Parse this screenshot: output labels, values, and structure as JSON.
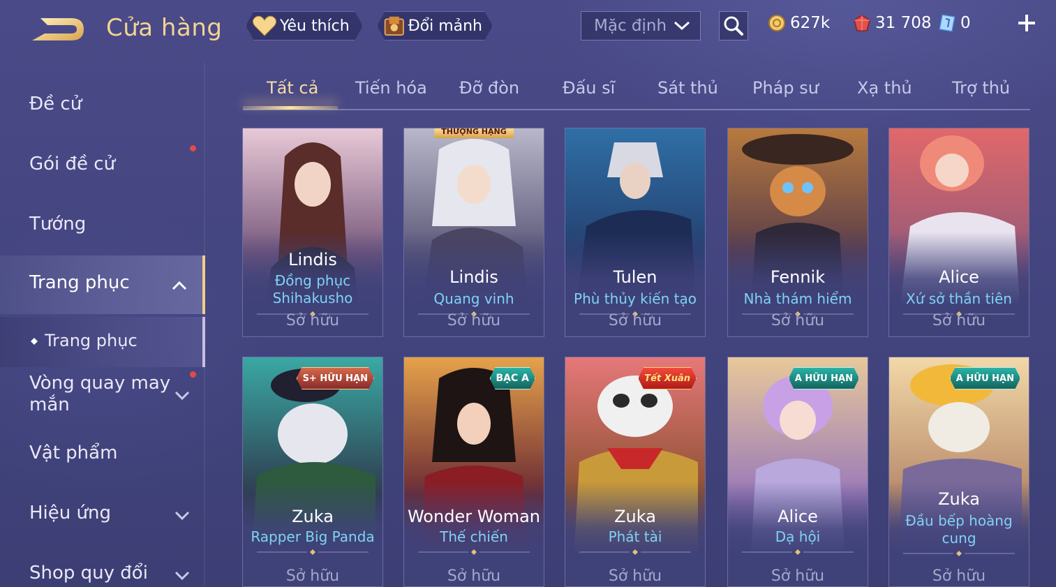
{
  "header": {
    "title": "Cửa hàng",
    "favorite_label": "Yêu thích",
    "exchange_label": "Đổi mảnh",
    "sort_value": "Mặc định",
    "gold": "627k",
    "gems": "31 708",
    "tickets": "0"
  },
  "sidebar": {
    "items": [
      {
        "label": "Đề cử"
      },
      {
        "label": "Gói đề cử"
      },
      {
        "label": "Tướng"
      },
      {
        "label": "Trang phục"
      },
      {
        "label": "Trang phục"
      },
      {
        "label": "Vòng quay may\nmắn"
      },
      {
        "label": "Vật phẩm"
      },
      {
        "label": "Hiệu ứng"
      },
      {
        "label": "Shop quy đổi"
      }
    ]
  },
  "tabs": [
    "Tất cả",
    "Tiến hóa",
    "Đỡ đòn",
    "Đấu sĩ",
    "Sát thủ",
    "Pháp sư",
    "Xạ thủ",
    "Trợ thủ"
  ],
  "cards": [
    {
      "hero": "Lindis",
      "skin": "Đồng phục Shihakusho",
      "status": "Sở hữu",
      "badge": ""
    },
    {
      "hero": "Lindis",
      "skin": "Quang vinh",
      "status": "Sở hữu",
      "badge": "THƯỢNG HẠNG"
    },
    {
      "hero": "Tulen",
      "skin": "Phù thủy kiến tạo",
      "status": "Sở hữu",
      "badge": ""
    },
    {
      "hero": "Fennik",
      "skin": "Nhà thám hiểm",
      "status": "Sở hữu",
      "badge": ""
    },
    {
      "hero": "Alice",
      "skin": "Xứ sở thần tiên",
      "status": "Sở hữu",
      "badge": ""
    },
    {
      "hero": "Zuka",
      "skin": "Rapper Big Panda",
      "status": "Sở hữu",
      "badge": "S+ HỮU HẠN"
    },
    {
      "hero": "Wonder Woman",
      "skin": "Thế chiến",
      "status": "Sở hữu",
      "badge": "BẠC A"
    },
    {
      "hero": "Zuka",
      "skin": "Phát tài",
      "status": "Sở hữu",
      "badge": "Tết Xuân"
    },
    {
      "hero": "Alice",
      "skin": "Dạ hội",
      "status": "Sở hữu",
      "badge": "A HỮU HẠN"
    },
    {
      "hero": "Zuka",
      "skin": "Đầu bếp hoàng cung",
      "status": "Sở hữu",
      "badge": "A HỮU HẠN"
    }
  ],
  "colors": {
    "background": "#45467f",
    "title_gold": "#f2d493",
    "skin_name_cyan": "#7fd3f4",
    "active_accent": "#f0cf86",
    "notification_red": "#e24a4a"
  },
  "icons": {
    "back": "back-arrow-icon",
    "favorite": "heart-icon",
    "exchange": "shards-chest-icon",
    "sort": "chevron-down-icon",
    "search": "search-icon",
    "gold": "gold-coin-icon",
    "gem": "red-gem-icon",
    "ticket": "ticket-icon",
    "add": "plus-icon"
  }
}
